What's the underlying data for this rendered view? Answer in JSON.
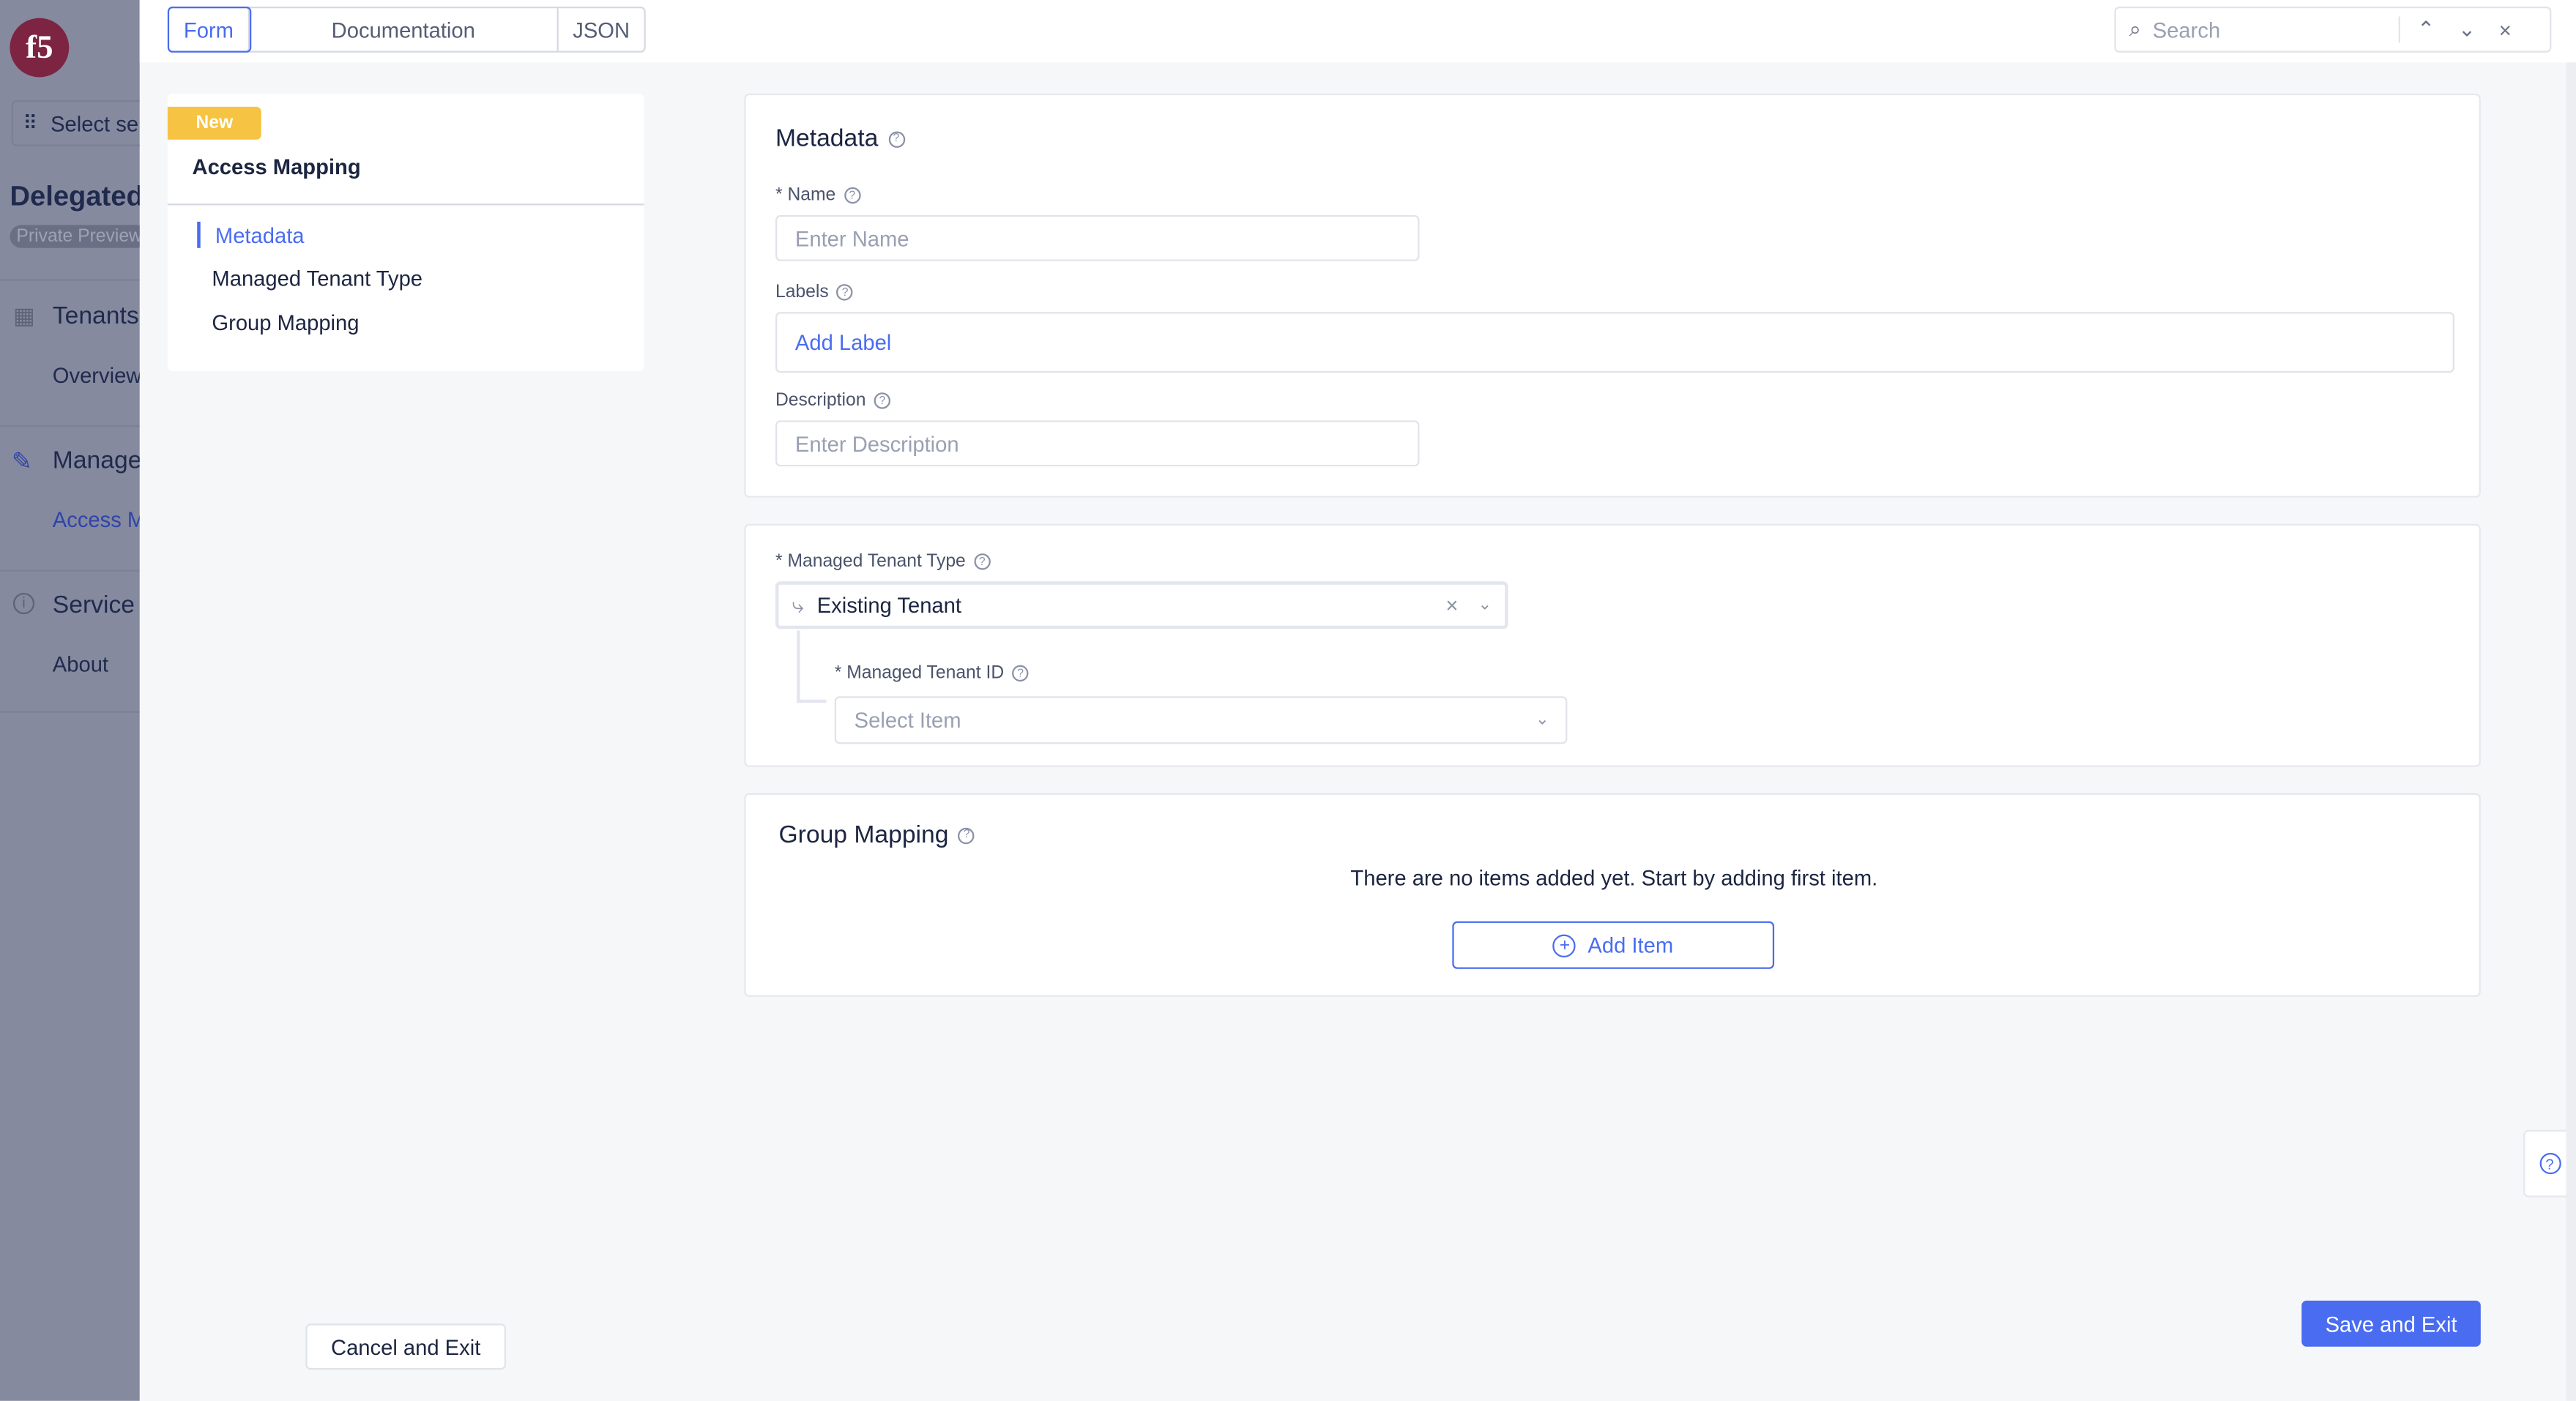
{
  "sidebar": {
    "workspace_select": "Select se",
    "title": "Delegated",
    "badge": "Private Preview",
    "sections": [
      {
        "label": "Tenants",
        "items": [
          "Overview"
        ]
      },
      {
        "label": "Manage",
        "items": [
          "Access M"
        ]
      },
      {
        "label": "Service",
        "items": [
          "About"
        ]
      }
    ]
  },
  "tabs": [
    "Form",
    "Documentation",
    "JSON"
  ],
  "search": {
    "placeholder": "Search"
  },
  "nav": {
    "badge": "New",
    "title": "Access Mapping",
    "items": [
      "Metadata",
      "Managed Tenant Type",
      "Group Mapping"
    ],
    "active": "Metadata"
  },
  "metadata": {
    "title": "Metadata",
    "name_label": "* Name",
    "name_placeholder": "Enter Name",
    "labels_label": "Labels",
    "add_label": "Add Label",
    "description_label": "Description",
    "description_placeholder": "Enter Description"
  },
  "tenant": {
    "type_label": "* Managed Tenant Type",
    "type_value": "Existing Tenant",
    "id_label": "* Managed Tenant ID",
    "id_placeholder": "Select Item"
  },
  "group": {
    "title": "Group Mapping",
    "empty": "There are no items added yet. Start by adding first item.",
    "add_button": "Add Item"
  },
  "footer": {
    "cancel": "Cancel and Exit",
    "save": "Save and Exit"
  },
  "colors": {
    "accent": "#4a6cf0",
    "badge": "#f6c343",
    "brand": "#8b1b3a"
  }
}
